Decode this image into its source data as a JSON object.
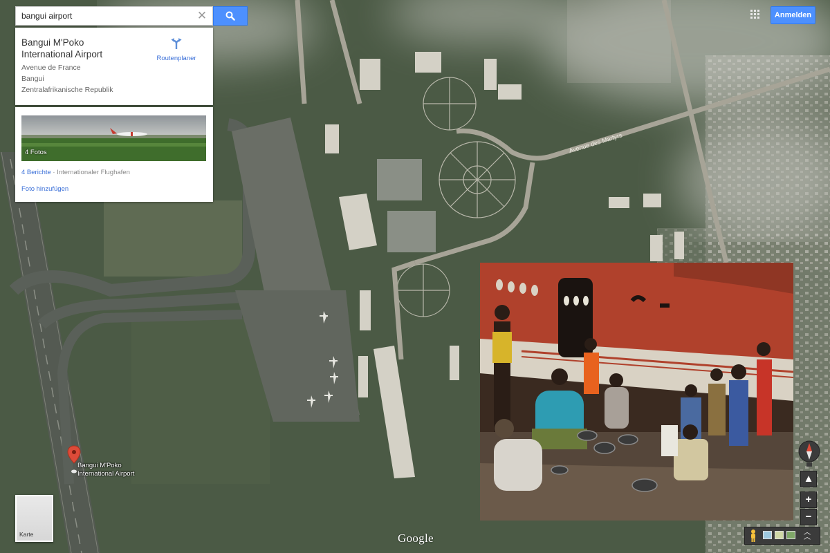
{
  "search": {
    "value": "bangui airport",
    "placeholder": "",
    "clear_icon": "close-icon",
    "button_icon": "search-icon"
  },
  "place": {
    "name": "Bangui M'Poko International Airport",
    "address_lines": [
      "Avenue de France",
      "Bangui",
      "Zentralafrikanische Republik"
    ],
    "route_label": "Routenplaner",
    "route_icon": "directions-icon"
  },
  "photos": {
    "count_label": "4 Fotos",
    "reviews_link": "4 Berichte",
    "category": " · Internationaler Flughafen",
    "add_photo": "Foto hinzufügen"
  },
  "header": {
    "signin_label": "Anmelden",
    "apps_icon": "apps-grid-icon"
  },
  "map": {
    "marker_label_line1": "Bangui M'Poko",
    "marker_label_line2": "International Airport",
    "road_label": "Avenue des Martyrs",
    "layer_label": "Karte",
    "logo": "Google",
    "zoom_in": "+",
    "zoom_out": "−",
    "expand_icon": "chevron-double-up-icon",
    "marker_color": "#dd4b39"
  },
  "colors": {
    "accent": "#4d90fe",
    "link": "#3a6fd8"
  }
}
